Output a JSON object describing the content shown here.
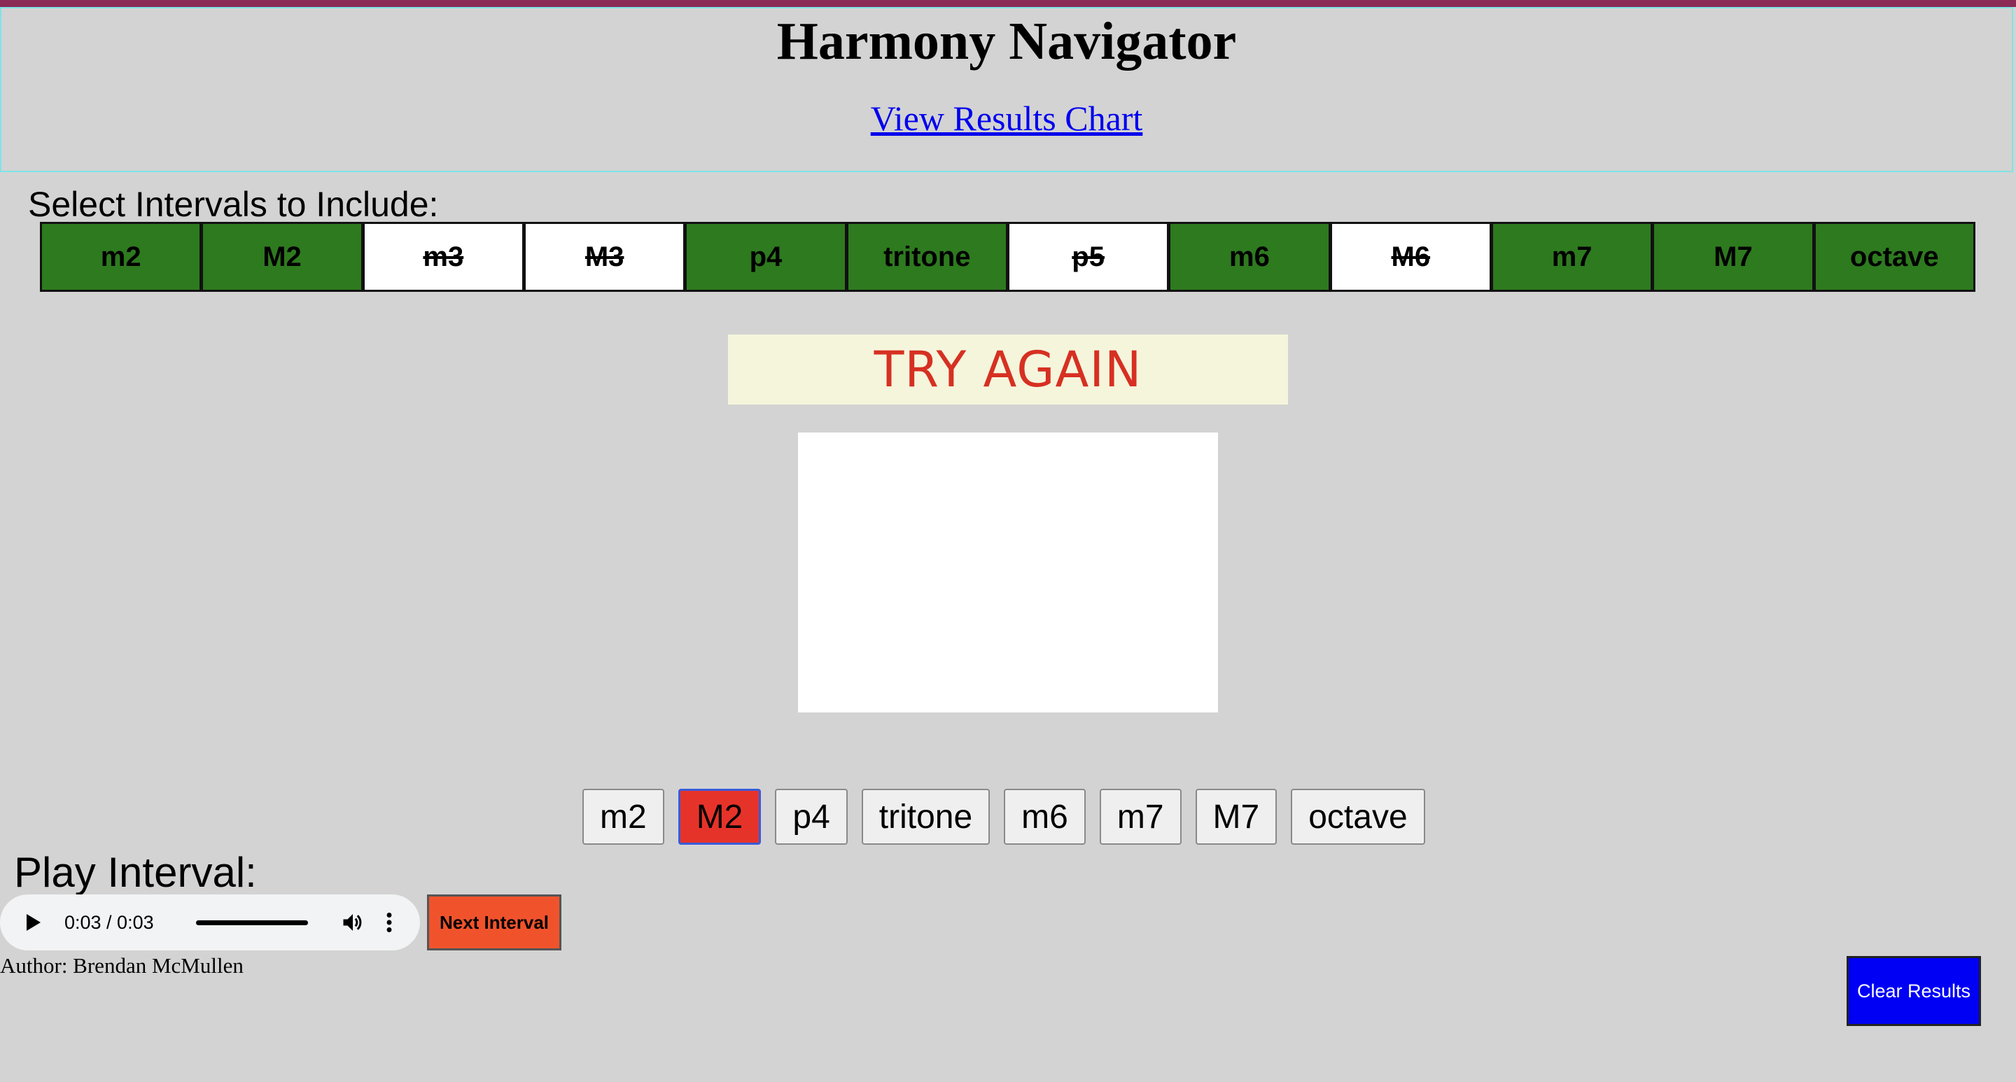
{
  "header": {
    "title": "Harmony Navigator",
    "results_link": "View Results Chart"
  },
  "selector": {
    "label": "Select Intervals to Include:",
    "intervals": [
      {
        "label": "m2",
        "included": true
      },
      {
        "label": "M2",
        "included": true
      },
      {
        "label": "m3",
        "included": false
      },
      {
        "label": "M3",
        "included": false
      },
      {
        "label": "p4",
        "included": true
      },
      {
        "label": "tritone",
        "included": true
      },
      {
        "label": "p5",
        "included": false
      },
      {
        "label": "m6",
        "included": true
      },
      {
        "label": "M6",
        "included": false
      },
      {
        "label": "m7",
        "included": true
      },
      {
        "label": "M7",
        "included": true
      },
      {
        "label": "octave",
        "included": true
      }
    ]
  },
  "feedback": {
    "message": "TRY AGAIN"
  },
  "answers": {
    "buttons": [
      "m2",
      "M2",
      "p4",
      "tritone",
      "m6",
      "m7",
      "M7",
      "octave"
    ],
    "wrong_selection": "M2"
  },
  "player": {
    "label": "Play Interval:",
    "time": "0:03 / 0:03",
    "progress": 1.0,
    "play_icon": "play-icon",
    "volume_icon": "volume-icon",
    "more_icon": "more-options-icon"
  },
  "controls": {
    "next_label": "Next Interval",
    "clear_label": "Clear Results"
  },
  "footer": {
    "author": "Author: Brendan McMullen"
  },
  "colors": {
    "included": "#2e7a1f",
    "excluded": "#ffffff",
    "feedback_text": "#d63022",
    "feedback_bg": "#f5f5dc",
    "wrong_answer": "#e6332a",
    "next_button": "#f0532c",
    "clear_button": "#0000f5"
  }
}
